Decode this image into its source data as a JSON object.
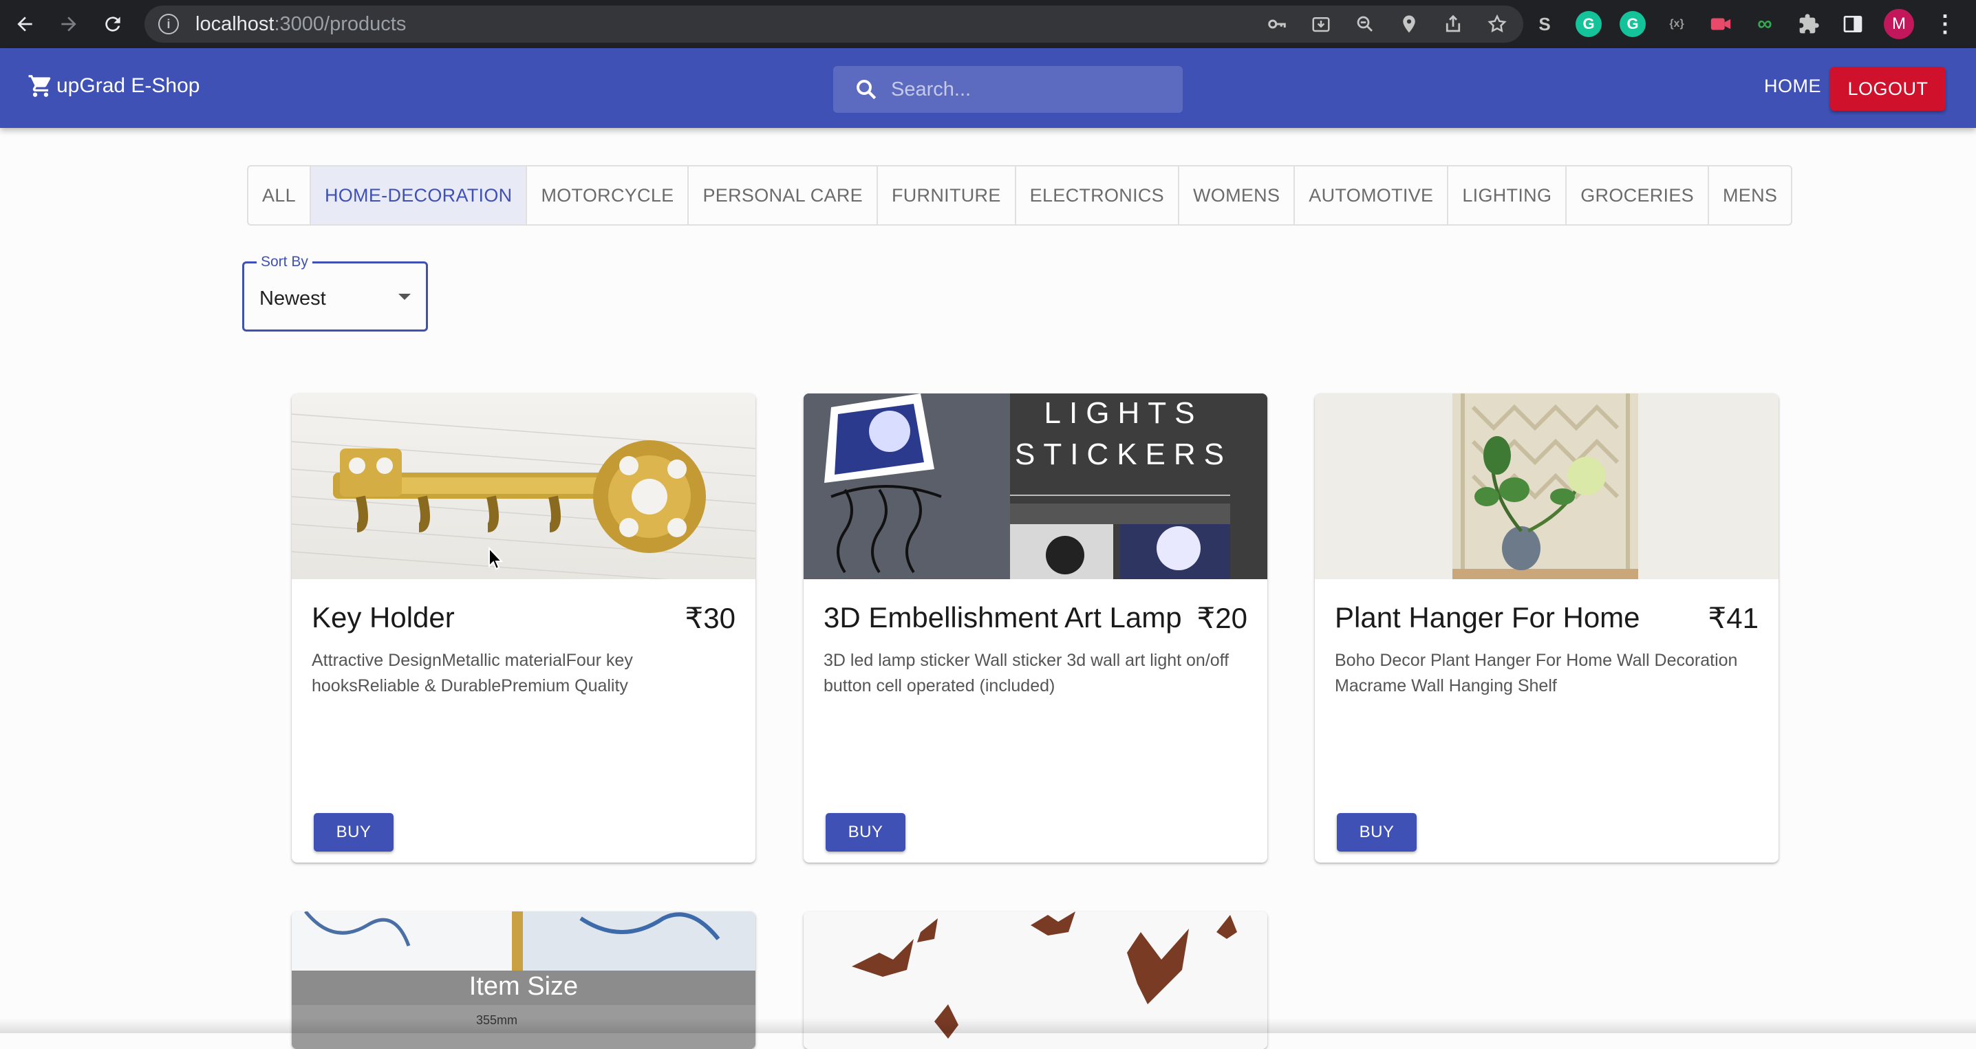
{
  "browser": {
    "url_host": "localhost",
    "url_path": ":3000/products",
    "avatar_letter": "M"
  },
  "header": {
    "brand": "upGrad E-Shop",
    "search_placeholder": "Search...",
    "home_label": "HOME",
    "logout_label": "LOGOUT",
    "accent_color": "#3f51b5",
    "logout_color": "#d0112b"
  },
  "categories": [
    {
      "label": "ALL",
      "active": false
    },
    {
      "label": "HOME-DECORATION",
      "active": true
    },
    {
      "label": "MOTORCYCLE",
      "active": false
    },
    {
      "label": "PERSONAL CARE",
      "active": false
    },
    {
      "label": "FURNITURE",
      "active": false
    },
    {
      "label": "ELECTRONICS",
      "active": false
    },
    {
      "label": "WOMENS",
      "active": false
    },
    {
      "label": "AUTOMOTIVE",
      "active": false
    },
    {
      "label": "LIGHTING",
      "active": false
    },
    {
      "label": "GROCERIES",
      "active": false
    },
    {
      "label": "MENS",
      "active": false
    }
  ],
  "sort": {
    "label": "Sort By",
    "value": "Newest"
  },
  "products": [
    {
      "name": "Key Holder",
      "price": "₹30",
      "description": "Attractive DesignMetallic materialFour key hooksReliable & DurablePremium Quality",
      "buy_label": "BUY"
    },
    {
      "name": "3D Embellishment Art Lamp",
      "price": "₹20",
      "description": "3D led lamp sticker Wall sticker 3d wall art light on/off button cell operated (included)",
      "buy_label": "BUY",
      "image_text_1": "LIGHTS",
      "image_text_2": "STICKERS"
    },
    {
      "name": "Plant Hanger For Home",
      "price": "₹41",
      "description": "Boho Decor Plant Hanger For Home Wall Decoration Macrame Wall Hanging Shelf",
      "buy_label": "BUY"
    }
  ],
  "partial_products": [
    {
      "image_text_1": "Item Size",
      "image_text_2": "355mm"
    },
    {}
  ]
}
